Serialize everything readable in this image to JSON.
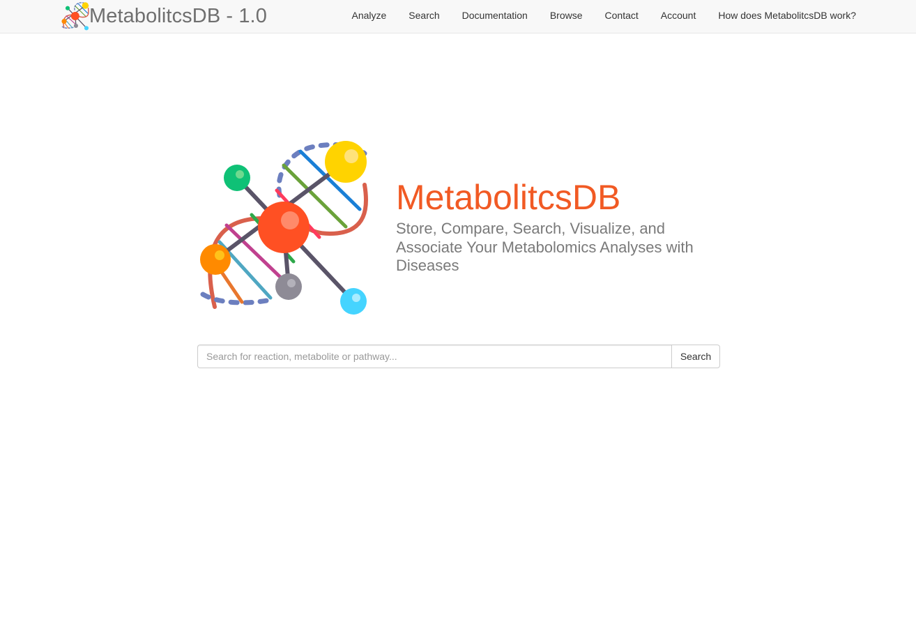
{
  "navbar": {
    "brand": "MetabolitcsDB - 1.0",
    "links": [
      {
        "label": "Analyze"
      },
      {
        "label": "Search"
      },
      {
        "label": "Documentation"
      },
      {
        "label": "Browse"
      },
      {
        "label": "Contact"
      },
      {
        "label": "Account"
      },
      {
        "label": "How does MetabolitcsDB work?"
      }
    ]
  },
  "hero": {
    "title": "MetabolitcsDB",
    "tagline": "Store, Compare, Search, Visualize, and Associate Your Metabolomics Analyses with Diseases"
  },
  "search": {
    "placeholder": "Search for reaction, metabolite or pathway...",
    "value": "",
    "button_label": "Search"
  },
  "colors": {
    "title": "#f15a24",
    "navbar_bg": "#f8f8f8",
    "tagline": "#7a7a7a"
  },
  "icons": {
    "brand_logo": "dna-molecule-logo",
    "hero_art": "dna-molecule-illustration"
  }
}
